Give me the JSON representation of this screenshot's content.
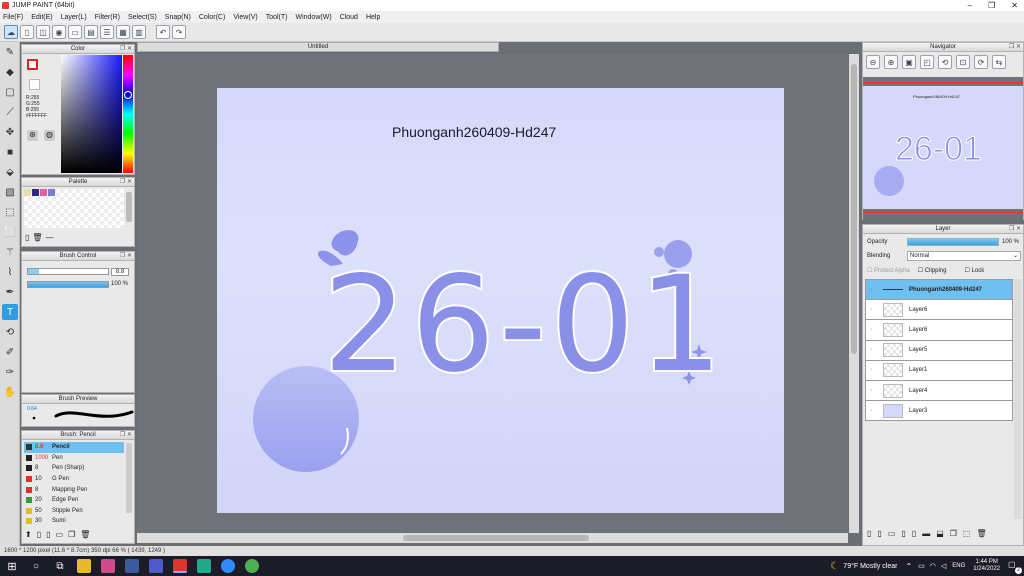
{
  "window": {
    "title": "JUMP PAINT (64bit)",
    "minimize": "–",
    "maximize": "❐",
    "close": "✕"
  },
  "menu": [
    "File(F)",
    "Edit(E)",
    "Layer(L)",
    "Filter(R)",
    "Select(S)",
    "Snap(N)",
    "Color(C)",
    "View(V)",
    "Tool(T)",
    "Window(W)",
    "Cloud",
    "Help"
  ],
  "panels": {
    "color": {
      "title": "Color",
      "r": "R:255",
      "g": "G:255",
      "b": "B:255",
      "hex": "#FFFFFF"
    },
    "palette": {
      "title": "Palette",
      "colors": [
        "#e8e0a0",
        "#2a2a8a",
        "#e060a0",
        "#7b7bd8"
      ]
    },
    "brush_control": {
      "title": "Brush Control",
      "size": "8.8",
      "opacity": "100 %"
    },
    "brush_preview": {
      "title": "Brush Preview",
      "value": "0.64"
    },
    "brush_list": {
      "title": "Brush: Pencil",
      "items": [
        {
          "size": "8.8",
          "name": "Pencil",
          "color": "#333333",
          "selected": true
        },
        {
          "size": "1000",
          "name": "Pen",
          "color": "#222222"
        },
        {
          "size": "8",
          "name": "Pen (Sharp)",
          "color": "#222222"
        },
        {
          "size": "10",
          "name": "G Pen",
          "color": "#e03030"
        },
        {
          "size": "8",
          "name": "Mapping Pen",
          "color": "#e03030"
        },
        {
          "size": "20",
          "name": "Edge Pen",
          "color": "#30a030"
        },
        {
          "size": "50",
          "name": "Stipple Pen",
          "color": "#e0c020"
        },
        {
          "size": "30",
          "name": "Sumi",
          "color": "#e0c020"
        }
      ]
    },
    "navigator": {
      "title": "Navigator"
    },
    "layer": {
      "title": "Layer",
      "opacity_label": "Opacity",
      "opacity_value": "100 %",
      "blending_label": "Blending",
      "blending_value": "Normal",
      "protect_alpha": "Protect Alpha",
      "clipping": "Clipping",
      "lock": "Lock",
      "layers": [
        {
          "name": "Phuonganh260409-Hd247",
          "selected": true
        },
        {
          "name": "Layer6"
        },
        {
          "name": "Layer6"
        },
        {
          "name": "Layer5"
        },
        {
          "name": "Layer1"
        },
        {
          "name": "Layer4"
        },
        {
          "name": "Layer3"
        }
      ]
    }
  },
  "document": {
    "tab": "Untitled",
    "watermark": "Phuonganh260409-Hd247",
    "art_text": "26-01"
  },
  "status": "1600 * 1200 pixel  (11.6 * 8.7cm)  350 dpi  66 %  ( 1439, 1249 )",
  "taskbar": {
    "weather": "79°F  Mostly clear",
    "lang": "ENG",
    "time": "1:44 PM",
    "date": "1/24/2022",
    "badge": "2"
  },
  "colors": {
    "accent": "#2f9be0",
    "art_fill": "#8a90e8",
    "canvas_bg": "#d6d8fb"
  }
}
